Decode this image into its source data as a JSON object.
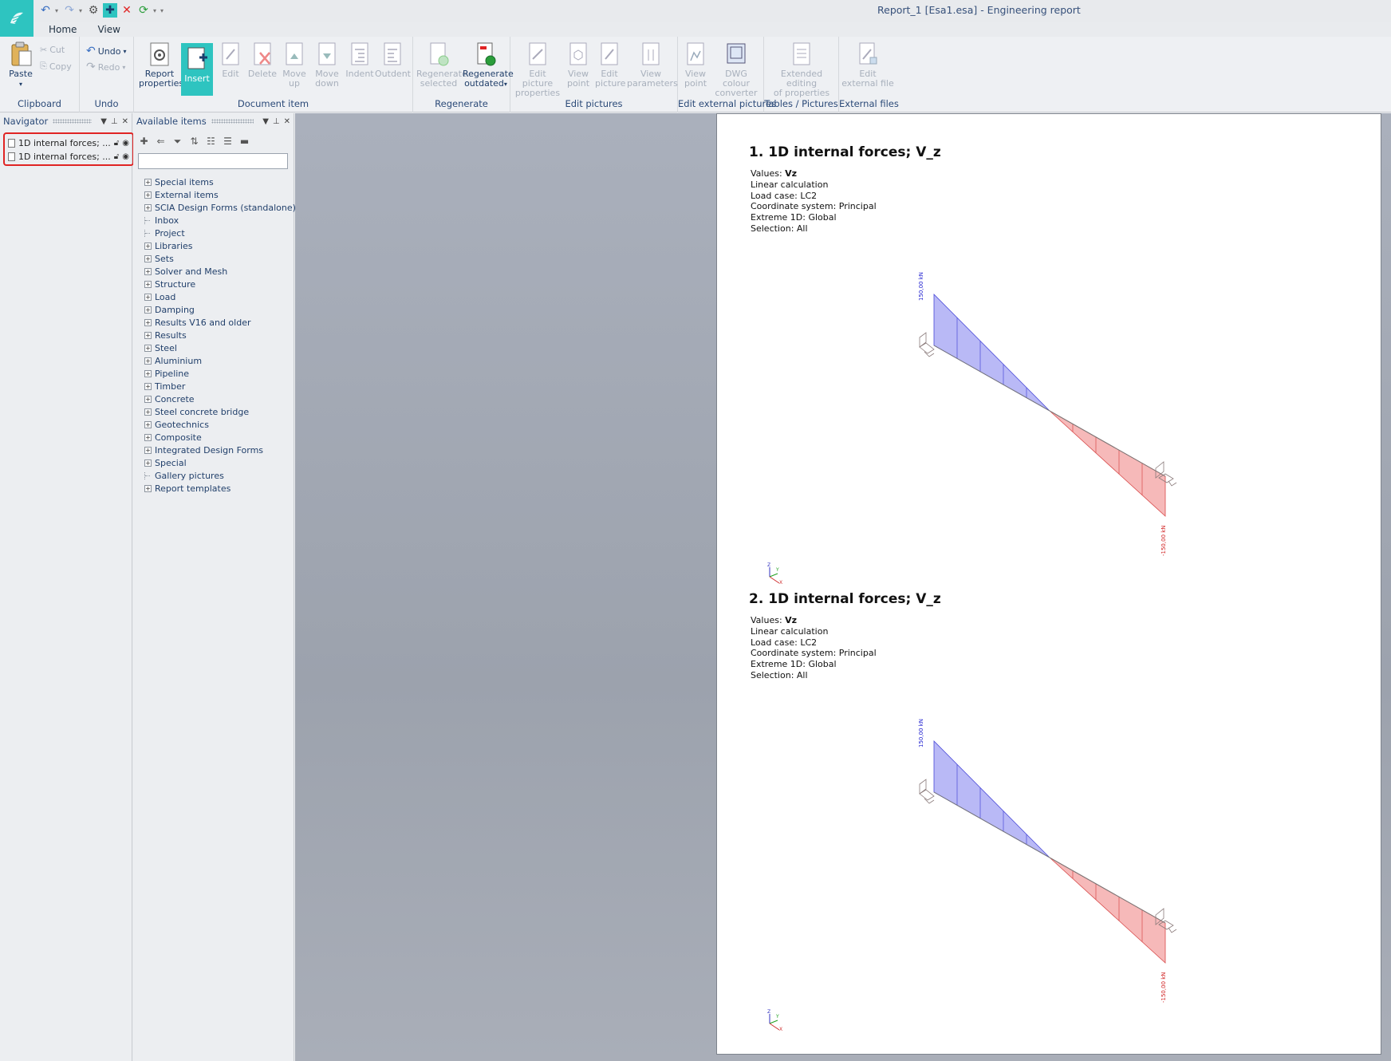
{
  "window": {
    "title": "Report_1 [Esa1.esa] - Engineering report"
  },
  "menu_tabs": [
    {
      "label": "Home"
    },
    {
      "label": "View"
    }
  ],
  "ribbon": {
    "clipboard": {
      "label": "Clipboard",
      "paste": "Paste",
      "cut": "Cut",
      "copy": "Copy"
    },
    "undo": {
      "label": "Undo",
      "undo": "Undo",
      "redo": "Redo"
    },
    "document_item": {
      "label": "Document item",
      "report_properties": [
        "Report",
        "properties"
      ],
      "insert": "Insert",
      "edit": "Edit",
      "delete": "Delete",
      "move_up": [
        "Move",
        "up"
      ],
      "move_down": [
        "Move",
        "down"
      ],
      "indent": "Indent",
      "outdent": "Outdent"
    },
    "regenerate": {
      "label": "Regenerate",
      "selected": [
        "Regenerate",
        "selected"
      ],
      "outdated": [
        "Regenerate",
        "outdated"
      ]
    },
    "edit_pictures": {
      "label": "Edit pictures",
      "picture_properties": [
        "Edit picture",
        "properties"
      ],
      "view_point": [
        "View",
        "point"
      ],
      "edit_picture": [
        "Edit",
        "picture"
      ],
      "view_parameters": [
        "View",
        "parameters"
      ]
    },
    "edit_external_pictures": {
      "label": "Edit external pictures",
      "view_point": [
        "View",
        "point"
      ],
      "dwg": [
        "DWG colour",
        "converter"
      ]
    },
    "tables_pictures": {
      "label": "Tables / Pictures",
      "extended": [
        "Extended editing",
        "of properties"
      ]
    },
    "external_files": {
      "label": "External files",
      "edit_file": [
        "Edit",
        "external file"
      ]
    }
  },
  "navigator": {
    "title": "Navigator",
    "items": [
      {
        "label": "1D internal forces; ..."
      },
      {
        "label": "1D internal forces; ..."
      }
    ]
  },
  "available": {
    "title": "Available items",
    "search_value": "",
    "tree": [
      {
        "label": "Special items",
        "expandable": true
      },
      {
        "label": "External items",
        "expandable": true
      },
      {
        "label": "SCIA Design Forms (standalone)",
        "expandable": true
      },
      {
        "label": "Inbox",
        "expandable": false
      },
      {
        "label": "Project",
        "expandable": false
      },
      {
        "label": "Libraries",
        "expandable": true
      },
      {
        "label": "Sets",
        "expandable": true
      },
      {
        "label": "Solver and Mesh",
        "expandable": true
      },
      {
        "label": "Structure",
        "expandable": true
      },
      {
        "label": "Load",
        "expandable": true
      },
      {
        "label": "Damping",
        "expandable": true
      },
      {
        "label": "Results V16 and older",
        "expandable": true
      },
      {
        "label": "Results",
        "expandable": true
      },
      {
        "label": "Steel",
        "expandable": true
      },
      {
        "label": "Aluminium",
        "expandable": true
      },
      {
        "label": "Pipeline",
        "expandable": true
      },
      {
        "label": "Timber",
        "expandable": true
      },
      {
        "label": "Concrete",
        "expandable": true
      },
      {
        "label": "Steel concrete bridge",
        "expandable": true
      },
      {
        "label": "Geotechnics",
        "expandable": true
      },
      {
        "label": "Composite",
        "expandable": true
      },
      {
        "label": "Integrated Design Forms",
        "expandable": true
      },
      {
        "label": "Special",
        "expandable": true
      },
      {
        "label": "Gallery pictures",
        "expandable": false
      },
      {
        "label": "Report templates",
        "expandable": true
      }
    ]
  },
  "report": {
    "sections": [
      {
        "title": "1. 1D internal forces; V_z",
        "values_label": "Values:",
        "values_value": "Vz",
        "lines": [
          "Linear calculation",
          "Load case: LC2",
          "Coordinate system: Principal",
          "Extreme 1D: Global",
          "Selection: All"
        ],
        "max_label": "150,00 kN",
        "min_label": "-150,00 kN"
      },
      {
        "title": "2. 1D internal forces; V_z",
        "values_label": "Values:",
        "values_value": "Vz",
        "lines": [
          "Linear calculation",
          "Load case: LC2",
          "Coordinate system: Principal",
          "Extreme 1D: Global",
          "Selection: All"
        ],
        "max_label": "150,00 kN",
        "min_label": "-150,00 kN"
      }
    ],
    "axis_labels": {
      "x": "X",
      "y": "Y",
      "z": "Z"
    }
  },
  "colors": {
    "accent": "#2ec4c0",
    "positive_fill": "#b9b9f6",
    "negative_fill": "#f6b9b9",
    "highlight": "#e02424"
  }
}
